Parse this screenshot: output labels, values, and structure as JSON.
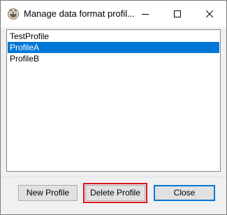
{
  "window": {
    "title": "Manage data format profil...",
    "icon": "app-logo-icon"
  },
  "titlebar_buttons": {
    "minimize_icon": "minimize-icon",
    "maximize_icon": "maximize-icon",
    "close_icon": "close-icon"
  },
  "profiles": {
    "items": [
      "TestProfile",
      "ProfileA",
      "ProfileB"
    ],
    "selected_index": 1
  },
  "buttons": {
    "new_label": "New Profile",
    "delete_label": "Delete Profile",
    "close_label": "Close"
  },
  "colors": {
    "selection": "#0078d7",
    "highlight": "#e0141e",
    "default_button_border": "#0078d7"
  }
}
